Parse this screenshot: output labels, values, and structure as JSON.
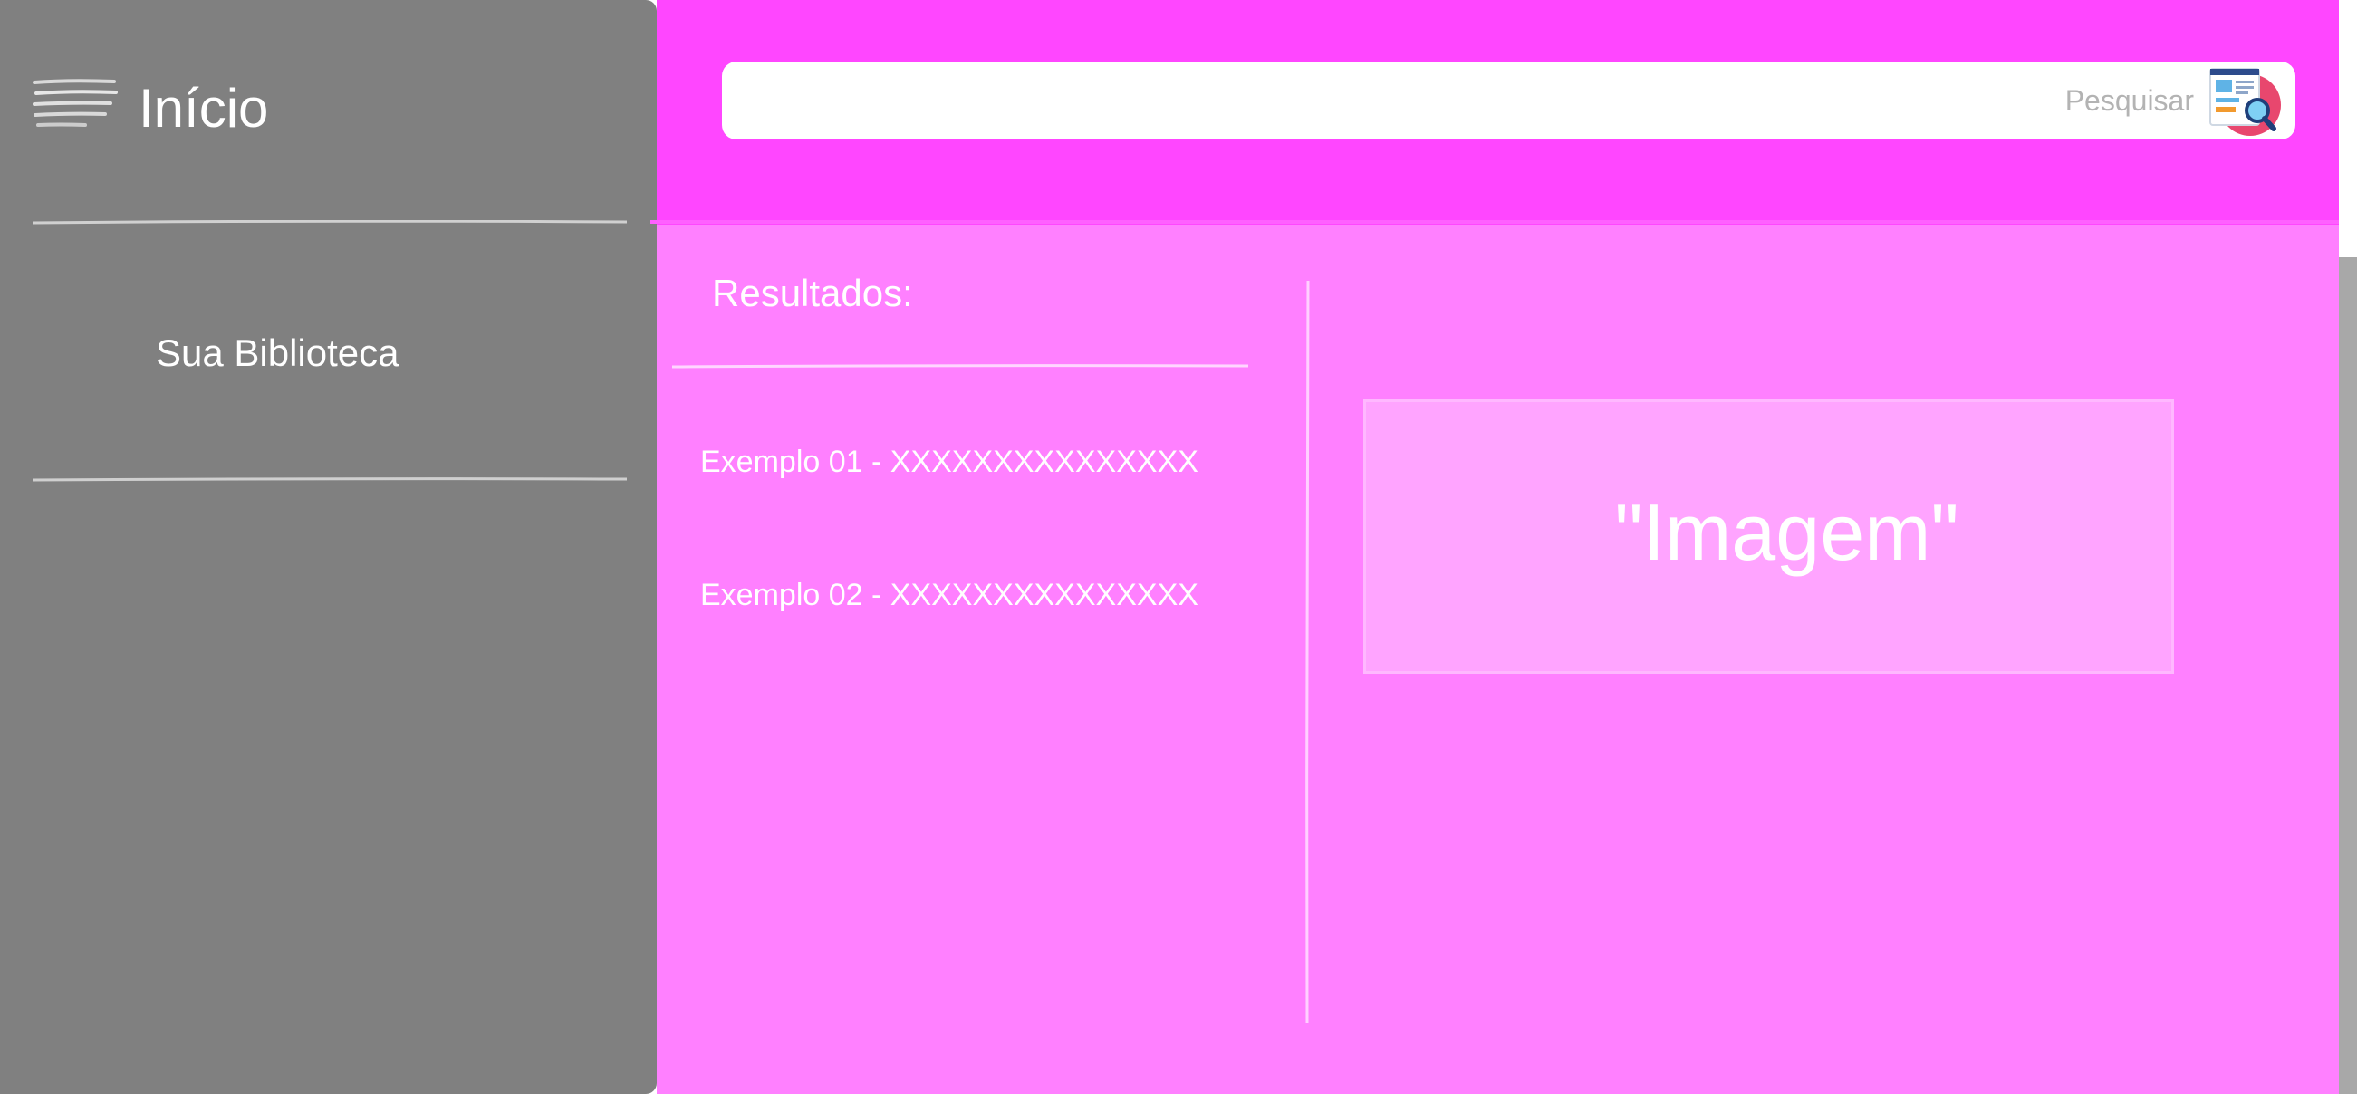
{
  "sidebar": {
    "menu_icon": "hamburger-menu-icon",
    "title": "Início",
    "items": [
      {
        "label": "Sua Biblioteca"
      }
    ]
  },
  "header": {
    "search": {
      "placeholder": "Pesquisar",
      "icon": "search-document-icon"
    }
  },
  "main": {
    "results_title": "Resultados:",
    "results": [
      {
        "label": "Exemplo 01 - XXXXXXXXXXXXXXX"
      },
      {
        "label": "Exemplo 02 - XXXXXXXXXXXXXXX"
      }
    ],
    "image_placeholder_label": "\"Imagem\""
  },
  "colors": {
    "sidebar_bg": "#808080",
    "header_bg": "#ff46ff",
    "main_bg": "#ff80ff",
    "image_bg": "#ffa4ff",
    "text": "#ffffff",
    "placeholder_text": "#b3b3b3"
  }
}
